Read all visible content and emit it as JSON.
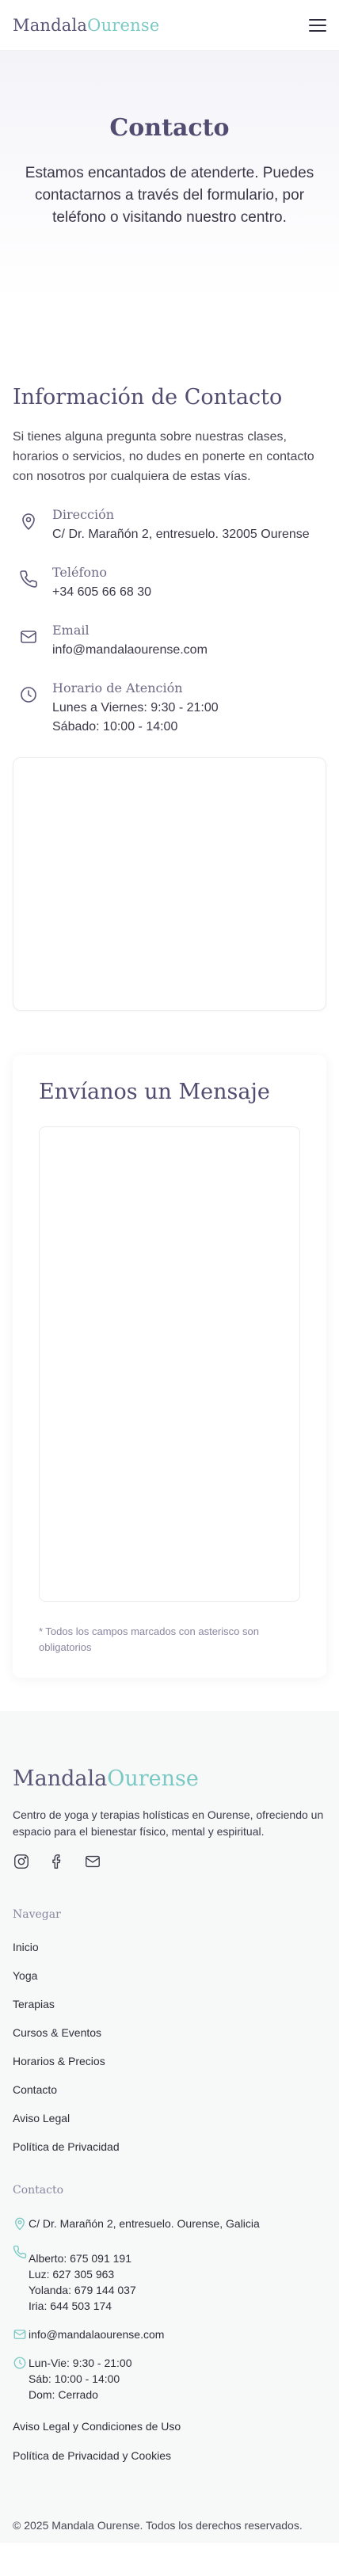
{
  "header": {
    "logo_part1": "Mandala",
    "logo_part2": "Ourense",
    "menu_icon": "hamburger-menu-icon"
  },
  "hero": {
    "title": "Contacto",
    "subtitle": "Estamos encantados de atenderte. Puedes contactarnos a través del formulario, por teléfono o visitando nuestro centro."
  },
  "info": {
    "title": "Información de Contacto",
    "lead": "Si tienes alguna pregunta sobre nuestras clases, horarios o servicios, no dudes en ponerte en contacto con nosotros por cualquiera de estas vías.",
    "items": [
      {
        "icon": "map-pin-icon",
        "label": "Dirección",
        "value": "C/ Dr. Marañón 2, entresuelo. 32005 Ourense"
      },
      {
        "icon": "phone-icon",
        "label": "Teléfono",
        "value": "+34 605 66 68 30"
      },
      {
        "icon": "mail-icon",
        "label": "Email",
        "value": "info@mandalaourense.com"
      },
      {
        "icon": "clock-icon",
        "label": "Horario de Atención",
        "value1": "Lunes a Viernes: 9:30 - 21:00",
        "value2": "Sábado: 10:00 - 14:00"
      }
    ]
  },
  "form": {
    "title": "Envíanos un Mensaje",
    "note": "* Todos los campos marcados con asterisco son obligatorios"
  },
  "footer": {
    "logo_part1": "Mandala",
    "logo_part2": "Ourense",
    "description": "Centro de yoga y terapias holísticas en Ourense, ofreciendo un espacio para el bienestar físico, mental y espiritual.",
    "social_icons": [
      "instagram-icon",
      "facebook-icon",
      "mail-icon"
    ],
    "nav_heading": "Navegar",
    "nav": [
      "Inicio",
      "Yoga",
      "Terapias",
      "Cursos & Eventos",
      "Horarios & Precios",
      "Contacto",
      "Aviso Legal",
      "Política de Privacidad"
    ],
    "contact_heading": "Contacto",
    "address": "C/ Dr. Marañón 2, entresuelo. Ourense, Galicia",
    "phones": [
      "Alberto: 675 091 191",
      "Luz: 627 305 963",
      "Yolanda: 679 144 037",
      "Iria: 644 503 174"
    ],
    "email": "info@mandalaourense.com",
    "hours": [
      "Lun-Vie: 9:30 - 21:00",
      "Sáb: 10:00 - 14:00",
      "Dom: Cerrado"
    ],
    "legal_links": [
      "Aviso Legal y Condiciones de Uso",
      "Política de Privacidad y Cookies"
    ],
    "copyright": "© 2025 Mandala Ourense. Todos los derechos reservados."
  },
  "colors": {
    "accent_purple": "#524c70",
    "accent_teal": "#7bc9c4"
  }
}
